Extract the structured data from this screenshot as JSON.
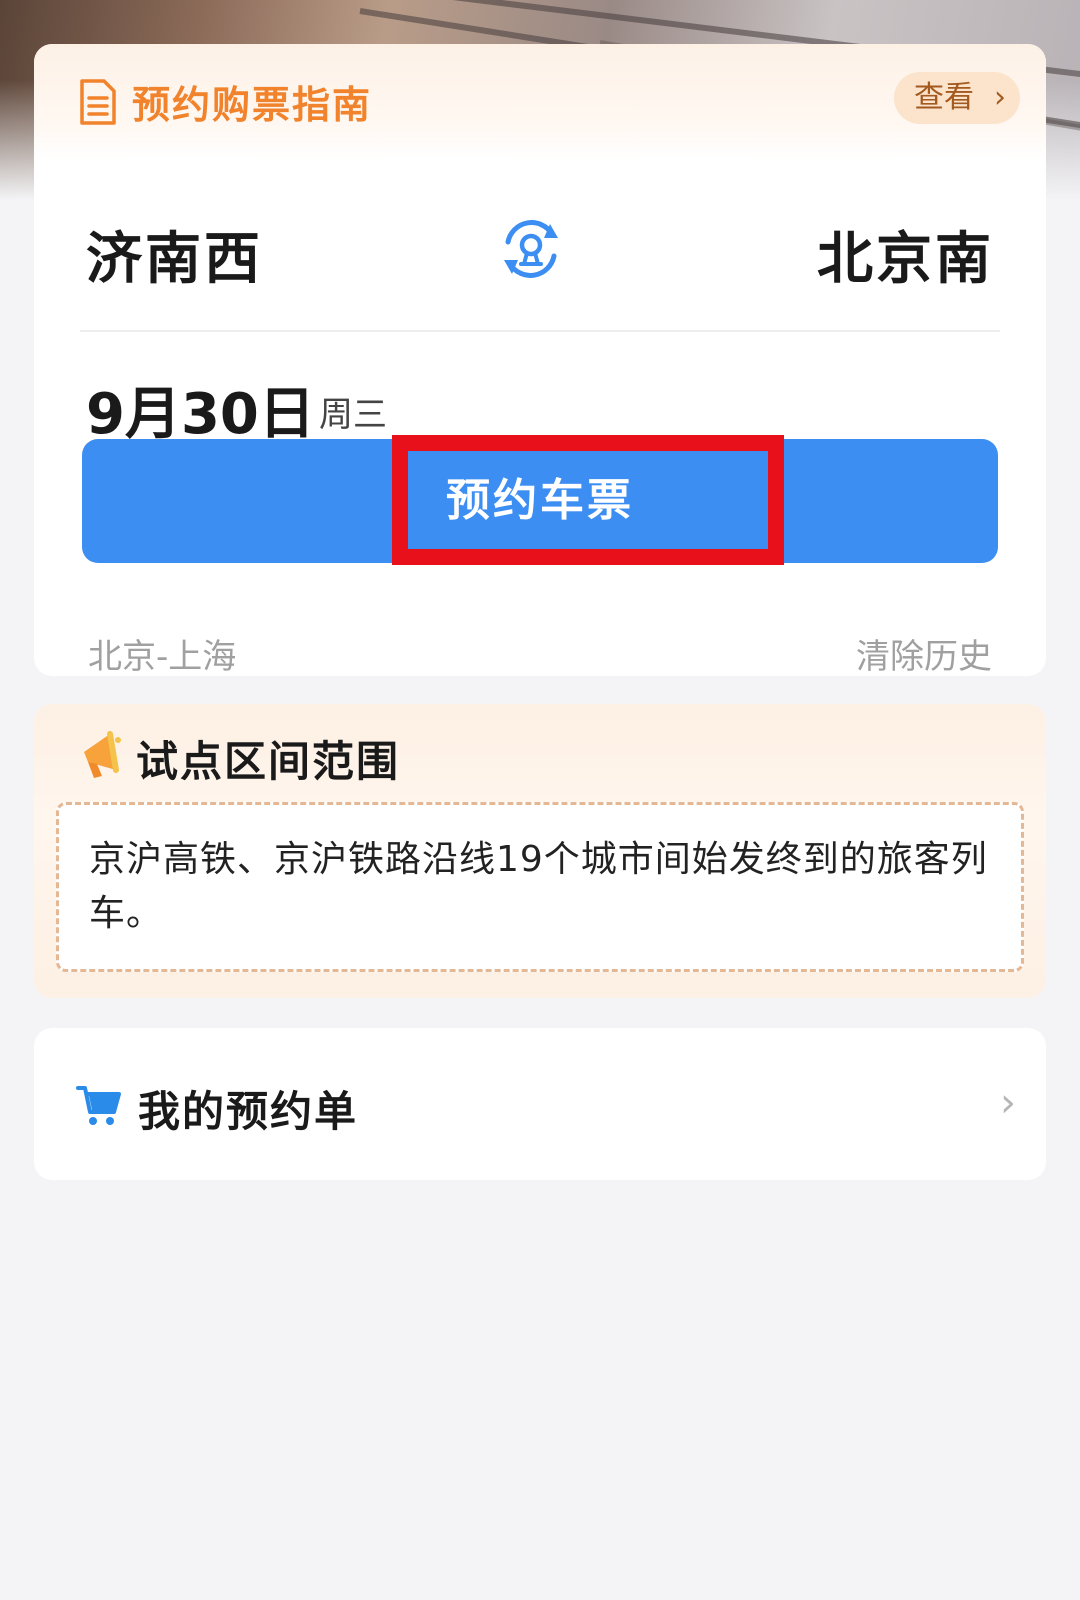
{
  "guide": {
    "title": "预约购票指南",
    "view_label": "查看",
    "view_chevron": "›"
  },
  "route": {
    "from": "济南西",
    "to": "北京南"
  },
  "date": {
    "value": "9月30日",
    "weekday": "周三"
  },
  "booking": {
    "button_label": "预约车票"
  },
  "history": {
    "item": "北京-上海",
    "clear_label": "清除历史"
  },
  "pilot": {
    "title": "试点区间范围",
    "description": "京沪高铁、京沪铁路沿线19个城市间始发终到的旅客列车。"
  },
  "orders": {
    "label": "我的预约单",
    "chevron": "›"
  },
  "colors": {
    "primary_blue": "#3d8ef2",
    "guide_orange": "#f0832c",
    "highlight_red": "#e8101a"
  },
  "icons": {
    "guide": "document-icon",
    "swap": "swap-stations-icon",
    "pilot": "megaphone-icon",
    "orders": "cart-icon"
  }
}
